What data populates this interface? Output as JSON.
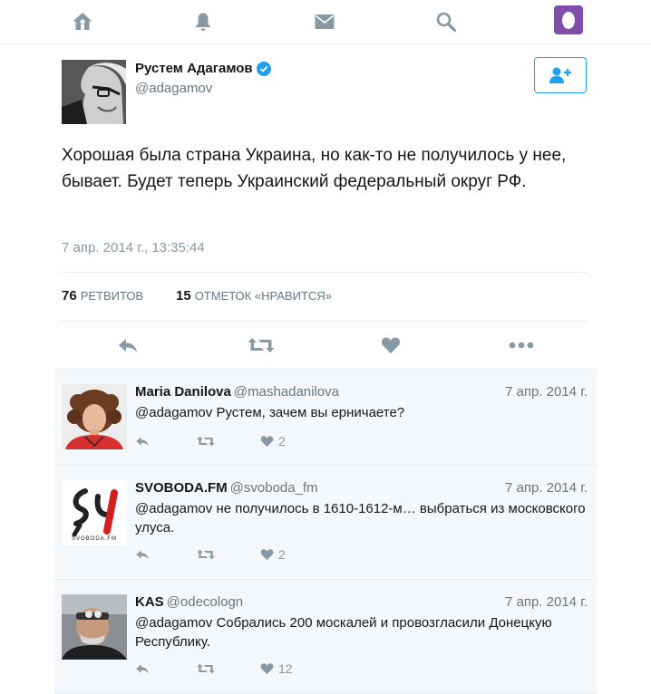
{
  "nav": {
    "icons": [
      "home-icon",
      "notifications-bell-icon",
      "messages-envelope-icon",
      "search-icon",
      "profile-avatar"
    ]
  },
  "tweet": {
    "author_name": "Рустем Адагамов",
    "author_handle": "@adagamov",
    "text": "Хорошая была страна Украина, но как-то не получилось у нее, бывает. Будет теперь Украинский федеральный округ РФ.",
    "timestamp": "7 апр. 2014 г., 13:35:44",
    "retweets_count": "76",
    "retweets_label": "РЕТВИТОВ",
    "likes_count": "15",
    "likes_label": "ОТМЕТОК «НРАВИТСЯ»"
  },
  "replies": [
    {
      "name": "Maria Danilova",
      "handle": "@mashadanilova",
      "date": "7 апр. 2014 г.",
      "text": "@adagamov Рустем, зачем вы ерничаете?",
      "likes": "2"
    },
    {
      "name": "SVOBODA.FM",
      "handle": "@svoboda_fm",
      "date": "7 апр. 2014 г.",
      "text": "@adagamov не получилось в 1610-1612-м… выбраться из московского улуса.",
      "likes": "2",
      "logo_text": "SVOBODA.FM"
    },
    {
      "name": "KAS",
      "handle": "@odecologn",
      "date": "7 апр. 2014 г.",
      "text": "@adagamov Собрались 200 москалей и провозгласили Донецкую Республику.",
      "likes": "12"
    }
  ],
  "colors": {
    "icon_grey": "#8899a6",
    "link_blue": "#1da1f2",
    "profile_purple": "#7e4ea8",
    "reply_bg": "#f5f8fa"
  }
}
